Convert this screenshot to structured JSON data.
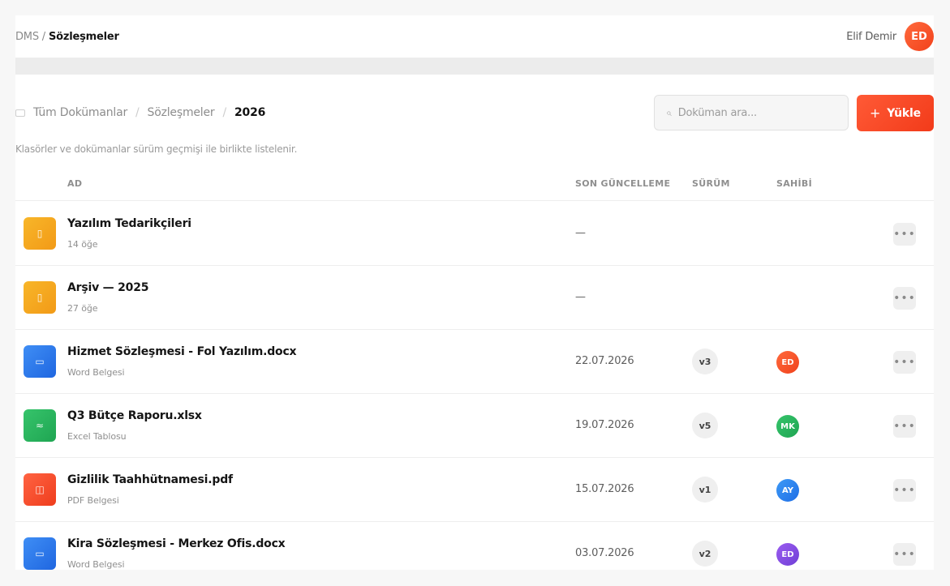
{
  "topbar": {
    "crumb_root": "DMS / ",
    "crumb_current": "Sözleşmeler",
    "user_name": "Elif Demir",
    "user_initials": "ED"
  },
  "breadcrumb": {
    "items": [
      "Tüm Dokümanlar",
      "Sözleşmeler",
      "2026"
    ],
    "separator": "/"
  },
  "search": {
    "placeholder": "Doküman ara..."
  },
  "upload": {
    "label": "Yükle"
  },
  "description": "Klasörler ve dokümanlar sürüm geçmişi ile birlikte listelenir.",
  "table": {
    "headers": [
      "AD",
      "SON GÜNCELLEME",
      "SÜRÜM",
      "SAHİBİ"
    ],
    "rows": [
      {
        "name": "Yazılım Tedarikçileri",
        "sub": "14 öğe",
        "date": "—",
        "version": "",
        "owner": "",
        "type": "folder"
      },
      {
        "name": "Arşiv — 2025",
        "sub": "27 öğe",
        "date": "—",
        "version": "",
        "owner": "",
        "type": "folder"
      },
      {
        "name": "Hizmet Sözleşmesi - Fol Yazılım.docx",
        "sub": "Word Belgesi",
        "date": "22.07.2026",
        "version": "v3",
        "owner": "ED",
        "type": "word"
      },
      {
        "name": "Q3 Bütçe Raporu.xlsx",
        "sub": "Excel Tablosu",
        "date": "19.07.2026",
        "version": "v5",
        "owner": "MK",
        "type": "excel"
      },
      {
        "name": "Gizlilik Taahhütnamesi.pdf",
        "sub": "PDF Belgesi",
        "date": "15.07.2026",
        "version": "v1",
        "owner": "AY",
        "type": "pdf"
      },
      {
        "name": "Kira Sözleşmesi - Merkez Ofis.docx",
        "sub": "Word Belgesi",
        "date": "03.07.2026",
        "version": "v2",
        "owner": "ED",
        "type": "word"
      }
    ]
  },
  "colors": {
    "accent": "#f23b1a",
    "folder": "#f5a623",
    "word": "#2f7df0",
    "excel": "#27b45b",
    "pdf": "#f24a2b",
    "owner_ed": "#f0532a",
    "owner_mk": "#22b35e",
    "owner_ay": "#2a86f3",
    "owner_ed2": "#8b4fe0"
  }
}
